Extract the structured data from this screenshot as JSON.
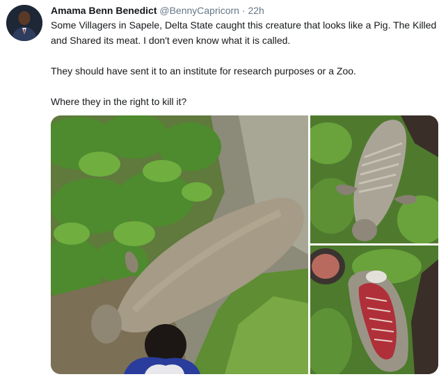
{
  "tweet": {
    "author_name": "Amama Benn Benedict",
    "handle": "@BennyCapricorn",
    "separator": "·",
    "time": "22h",
    "paragraphs": [
      "Some Villagers in Sapele, Delta State caught this creature that looks like a Pig. The Killed and Shared its meat. I don't even know what it is called.",
      "They should have sent it to an institute for research purposes or a Zoo.",
      "Where they in the right to kill it?"
    ]
  },
  "media": {
    "photos": [
      {
        "subject": "manatee-on-muddy-creek-bank"
      },
      {
        "subject": "manatee-belly-up-on-grass"
      },
      {
        "subject": "manatee-cut-open"
      }
    ]
  },
  "colors": {
    "text": "#14171a",
    "secondary_text": "#657786",
    "background": "#ffffff"
  }
}
